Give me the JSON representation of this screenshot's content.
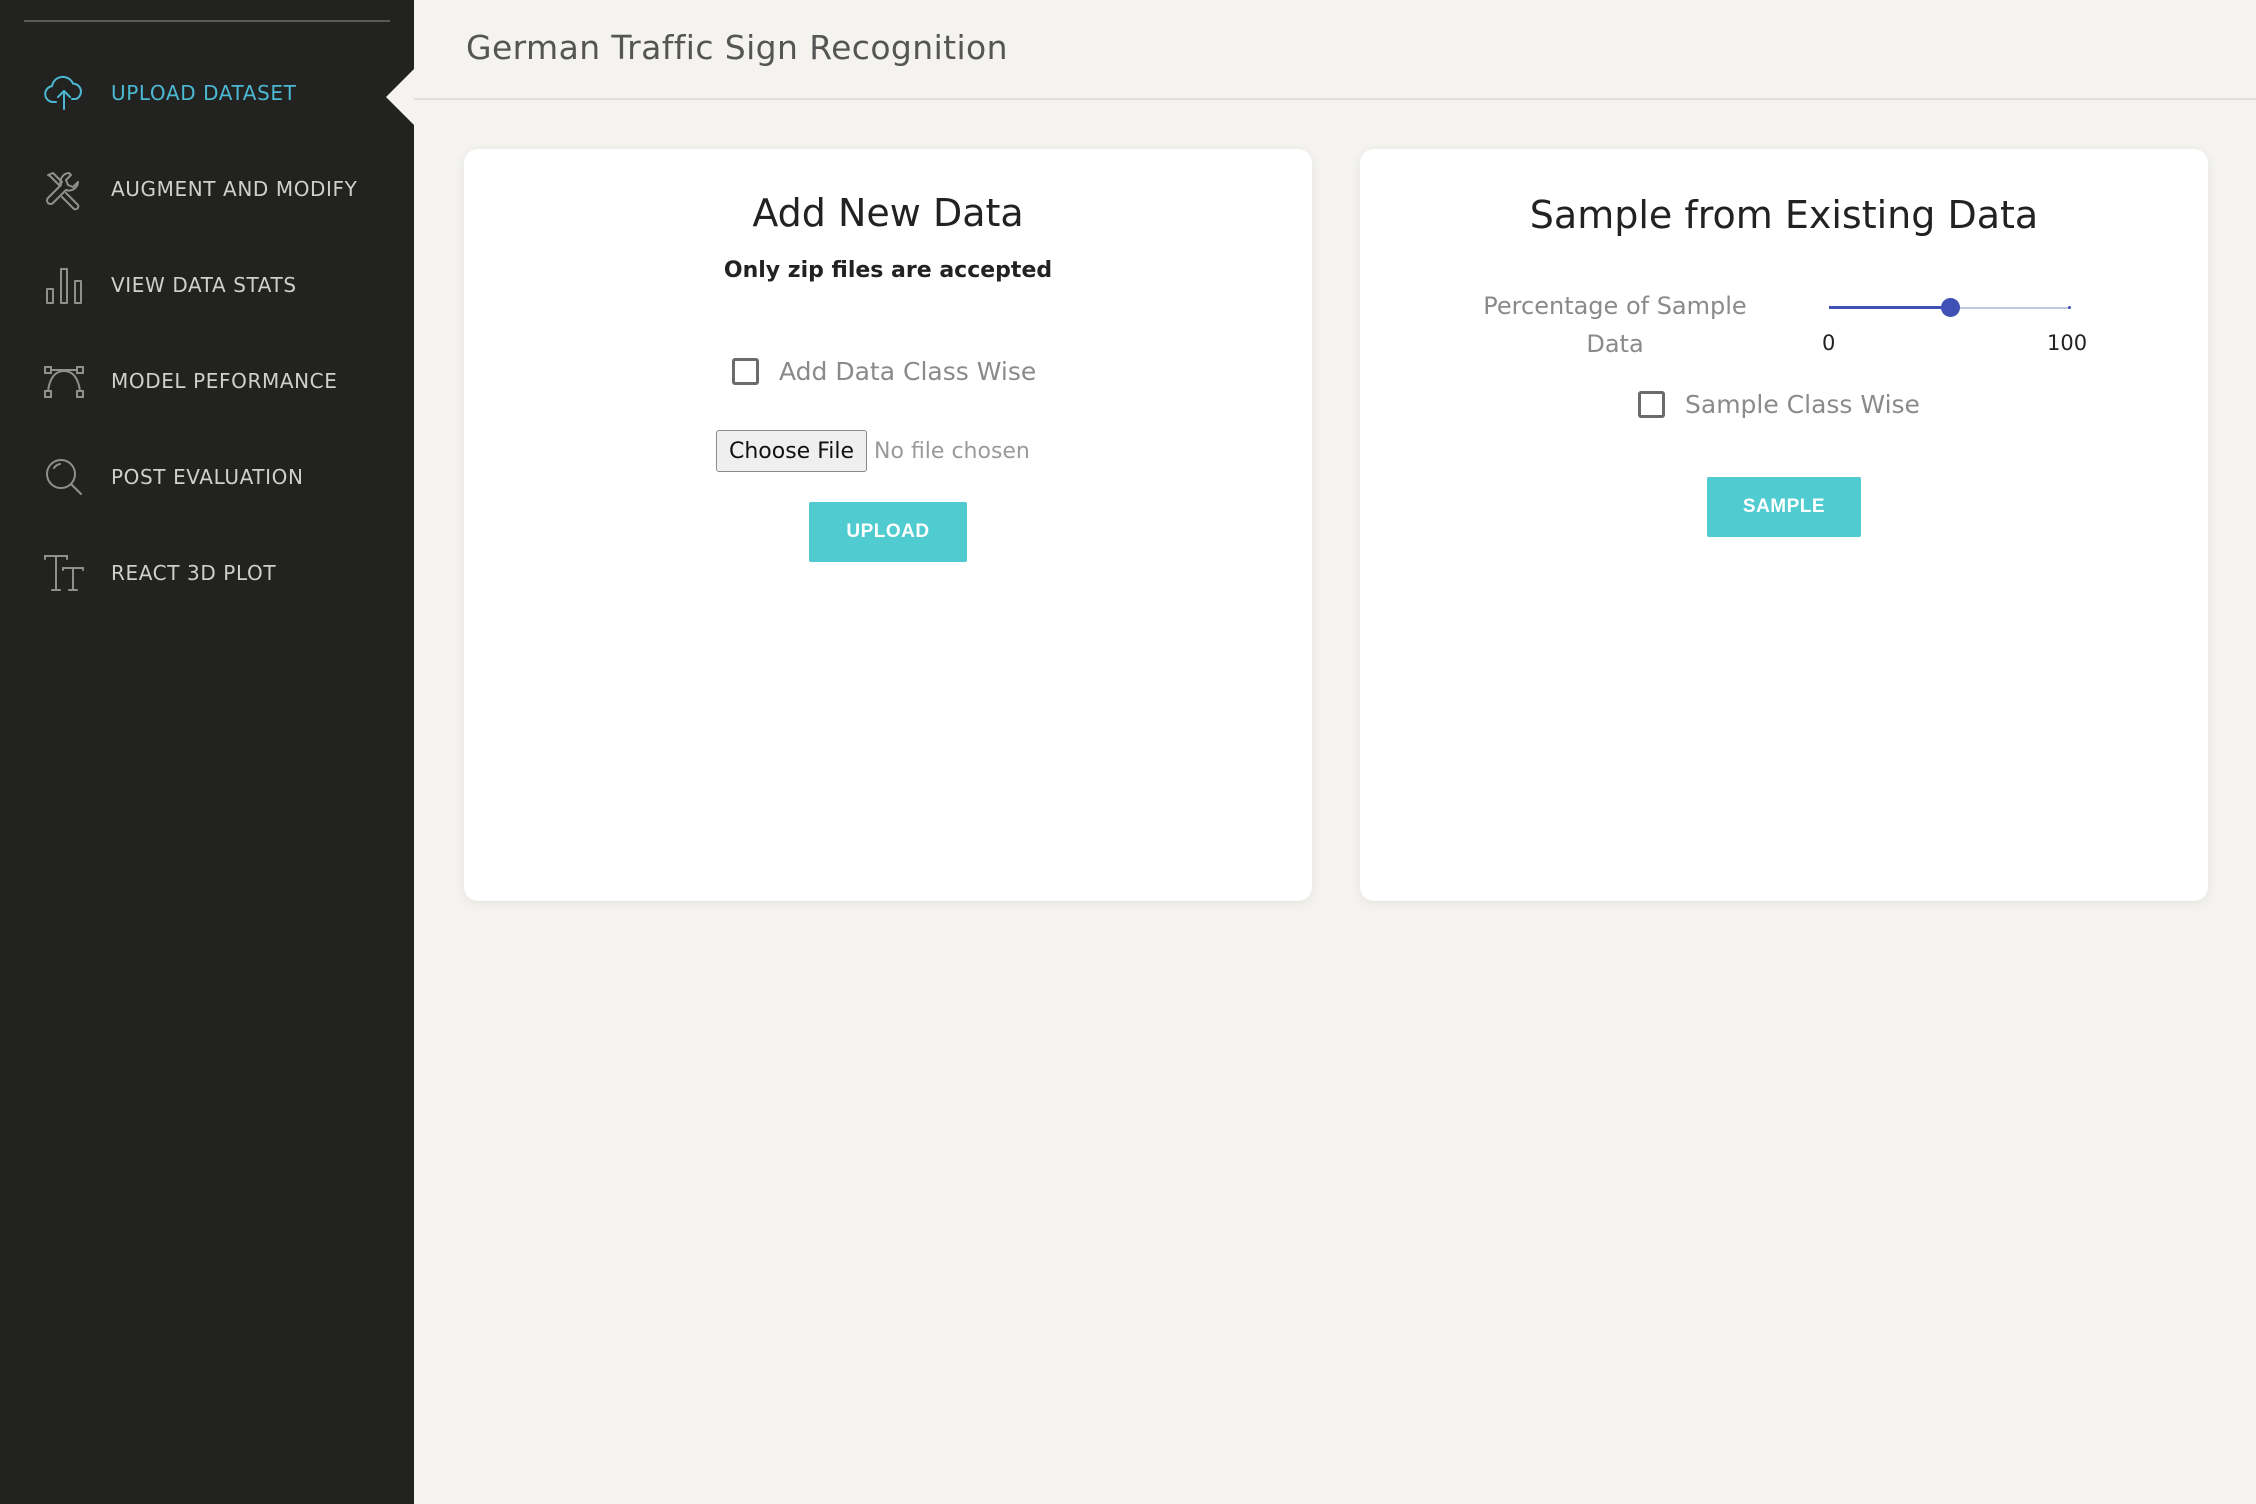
{
  "sidebar": {
    "items": [
      {
        "label": "UPLOAD DATASET",
        "icon": "cloud-upload-icon",
        "active": true
      },
      {
        "label": "AUGMENT AND MODIFY",
        "icon": "tools-icon",
        "active": false
      },
      {
        "label": "VIEW DATA STATS",
        "icon": "bar-chart-icon",
        "active": false
      },
      {
        "label": "MODEL PEFORMANCE",
        "icon": "bezier-curve-icon",
        "active": false
      },
      {
        "label": "POST EVALUATION",
        "icon": "search-icon",
        "active": false
      },
      {
        "label": "REACT 3D PLOT",
        "icon": "text-size-icon",
        "active": false
      }
    ]
  },
  "header": {
    "title": "German Traffic Sign Recognition"
  },
  "add_new_data": {
    "title": "Add New Data",
    "subtitle": "Only zip files are accepted",
    "class_wise_label": "Add Data Class Wise",
    "class_wise_checked": false,
    "file_button_label": "Choose File",
    "file_status": "No file chosen",
    "upload_label": "UPLOAD"
  },
  "sample_existing": {
    "title": "Sample from Existing Data",
    "slider_caption": "Percentage of Sample Data",
    "slider_min": "0",
    "slider_max": "100",
    "slider_value": 50,
    "class_wise_label": "Sample Class Wise",
    "class_wise_checked": false,
    "sample_label": "SAMPLE"
  },
  "colors": {
    "sidebar_bg": "#222220",
    "accent_active": "#4cb9d4",
    "button_teal": "#50cbd0",
    "slider_blue": "#3f51b5",
    "page_bg": "#f4f3ef"
  }
}
